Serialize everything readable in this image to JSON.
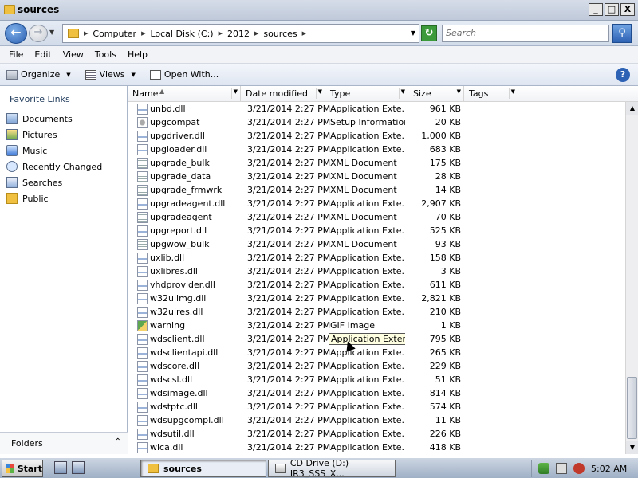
{
  "window": {
    "title": "sources",
    "buttons": {
      "minimize": "_",
      "maximize": "□",
      "close": "X"
    }
  },
  "address": {
    "crumbs": [
      "Computer",
      "Local Disk (C:)",
      "2012",
      "sources"
    ],
    "search_placeholder": "Search"
  },
  "menu": [
    "File",
    "Edit",
    "View",
    "Tools",
    "Help"
  ],
  "toolbar": {
    "organize": "Organize",
    "views": "Views",
    "open_with": "Open With...",
    "help": "?"
  },
  "nav": {
    "header": "Favorite Links",
    "items": [
      "Documents",
      "Pictures",
      "Music",
      "Recently Changed",
      "Searches",
      "Public"
    ],
    "folders": "Folders"
  },
  "columns": [
    "Name",
    "Date modified",
    "Type",
    "Size",
    "Tags"
  ],
  "files": [
    {
      "name": "unbd.dll",
      "date": "3/21/2014 2:27 PM",
      "type": "Application Exte...",
      "size": "961 KB",
      "icon": "dll-file-icon"
    },
    {
      "name": "upgcompat",
      "date": "3/21/2014 2:27 PM",
      "type": "Setup Information",
      "size": "20 KB",
      "icon": "inf-file-icon"
    },
    {
      "name": "upgdriver.dll",
      "date": "3/21/2014 2:27 PM",
      "type": "Application Exte...",
      "size": "1,000 KB",
      "icon": "dll-file-icon"
    },
    {
      "name": "upgloader.dll",
      "date": "3/21/2014 2:27 PM",
      "type": "Application Exte...",
      "size": "683 KB",
      "icon": "dll-file-icon"
    },
    {
      "name": "upgrade_bulk",
      "date": "3/21/2014 2:27 PM",
      "type": "XML Document",
      "size": "175 KB",
      "icon": "xml-file-icon"
    },
    {
      "name": "upgrade_data",
      "date": "3/21/2014 2:27 PM",
      "type": "XML Document",
      "size": "28 KB",
      "icon": "xml-file-icon"
    },
    {
      "name": "upgrade_frmwrk",
      "date": "3/21/2014 2:27 PM",
      "type": "XML Document",
      "size": "14 KB",
      "icon": "xml-file-icon"
    },
    {
      "name": "upgradeagent.dll",
      "date": "3/21/2014 2:27 PM",
      "type": "Application Exte...",
      "size": "2,907 KB",
      "icon": "dll-file-icon"
    },
    {
      "name": "upgradeagent",
      "date": "3/21/2014 2:27 PM",
      "type": "XML Document",
      "size": "70 KB",
      "icon": "xml-file-icon"
    },
    {
      "name": "upgreport.dll",
      "date": "3/21/2014 2:27 PM",
      "type": "Application Exte...",
      "size": "525 KB",
      "icon": "dll-file-icon"
    },
    {
      "name": "upgwow_bulk",
      "date": "3/21/2014 2:27 PM",
      "type": "XML Document",
      "size": "93 KB",
      "icon": "xml-file-icon"
    },
    {
      "name": "uxlib.dll",
      "date": "3/21/2014 2:27 PM",
      "type": "Application Exte...",
      "size": "158 KB",
      "icon": "dll-file-icon"
    },
    {
      "name": "uxlibres.dll",
      "date": "3/21/2014 2:27 PM",
      "type": "Application Exte...",
      "size": "3 KB",
      "icon": "dll-file-icon"
    },
    {
      "name": "vhdprovider.dll",
      "date": "3/21/2014 2:27 PM",
      "type": "Application Exte...",
      "size": "611 KB",
      "icon": "dll-file-icon"
    },
    {
      "name": "w32uiimg.dll",
      "date": "3/21/2014 2:27 PM",
      "type": "Application Exte...",
      "size": "2,821 KB",
      "icon": "dll-file-icon"
    },
    {
      "name": "w32uires.dll",
      "date": "3/21/2014 2:27 PM",
      "type": "Application Exte...",
      "size": "210 KB",
      "icon": "dll-file-icon"
    },
    {
      "name": "warning",
      "date": "3/21/2014 2:27 PM",
      "type": "GIF Image",
      "size": "1 KB",
      "icon": "gif-file-icon"
    },
    {
      "name": "wdsclient.dll",
      "date": "3/21/2014 2:27 PM",
      "type": "Application Extension",
      "size": "795 KB",
      "icon": "dll-file-icon",
      "focused": true
    },
    {
      "name": "wdsclientapi.dll",
      "date": "3/21/2014 2:27 PM",
      "type": "Application Exte...",
      "size": "265 KB",
      "icon": "dll-file-icon"
    },
    {
      "name": "wdscore.dll",
      "date": "3/21/2014 2:27 PM",
      "type": "Application Exte...",
      "size": "229 KB",
      "icon": "dll-file-icon"
    },
    {
      "name": "wdscsl.dll",
      "date": "3/21/2014 2:27 PM",
      "type": "Application Exte...",
      "size": "51 KB",
      "icon": "dll-file-icon"
    },
    {
      "name": "wdsimage.dll",
      "date": "3/21/2014 2:27 PM",
      "type": "Application Exte...",
      "size": "814 KB",
      "icon": "dll-file-icon"
    },
    {
      "name": "wdstptc.dll",
      "date": "3/21/2014 2:27 PM",
      "type": "Application Exte...",
      "size": "574 KB",
      "icon": "dll-file-icon"
    },
    {
      "name": "wdsupgcompl.dll",
      "date": "3/21/2014 2:27 PM",
      "type": "Application Exte...",
      "size": "11 KB",
      "icon": "dll-file-icon"
    },
    {
      "name": "wdsutil.dll",
      "date": "3/21/2014 2:27 PM",
      "type": "Application Exte...",
      "size": "226 KB",
      "icon": "dll-file-icon"
    },
    {
      "name": "wica.dll",
      "date": "3/21/2014 2:27 PM",
      "type": "Application Exte...",
      "size": "418 KB",
      "icon": "dll-file-icon"
    }
  ],
  "taskbar": {
    "start": "Start",
    "tasks": [
      "sources",
      "CD Drive (D:) IR3_SSS_X..."
    ],
    "clock": "5:02 AM"
  }
}
